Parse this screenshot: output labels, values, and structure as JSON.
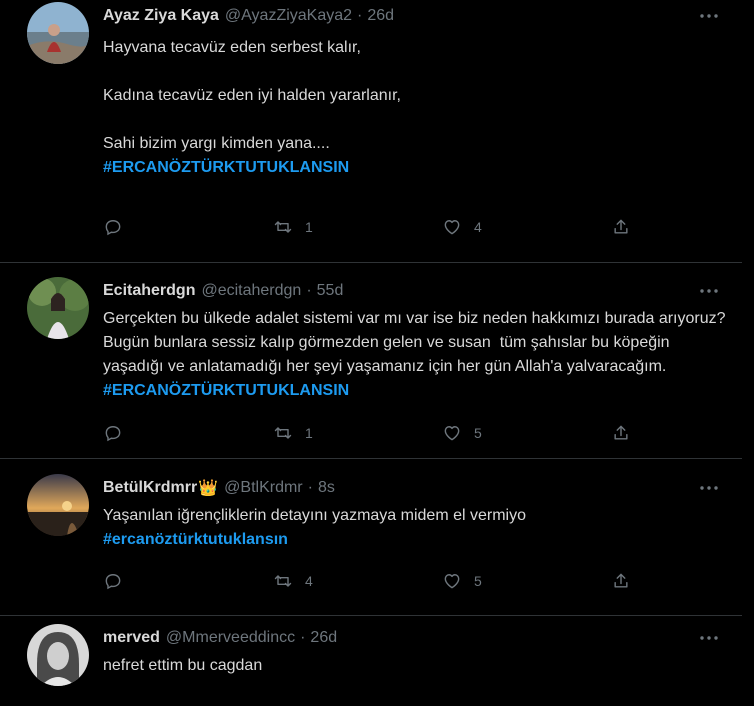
{
  "tweets": [
    {
      "name": "Ayaz Ziya Kaya",
      "handle": "@AyazZiyaKaya2",
      "separator": "·",
      "time": "26d",
      "text": "Hayvana tecavüz eden serbest kalır,\n\nKadına tecavüz eden iyi halden yararlanır,\n\nSahi bizim yargı kimden yana....\n",
      "hashtag": "#ERCANÖZTÜRKTUTUKLANSIN",
      "replies": "",
      "retweets": "1",
      "likes": "4"
    },
    {
      "name": "Ecitaherdgn",
      "handle": "@ecitaherdgn",
      "separator": "·",
      "time": "55d",
      "text": "Gerçekten bu ülkede adalet sistemi var mı var ise biz neden hakkımızı burada arıyoruz? Bugün bunlara sessiz kalıp görmezden gelen ve susan  tüm şahıslar bu köpeğin yaşadığı ve anlatamadığı her şeyi yaşamanız için her gün Allah'a yalvaracağım. ",
      "hashtag": "#ERCANÖZTÜRKTUTUKLANSIN",
      "replies": "",
      "retweets": "1",
      "likes": "5"
    },
    {
      "name": "BetülKrdmrr",
      "name_emoji": "👑",
      "handle": "@BtlKrdmr",
      "separator": "·",
      "time": "8s",
      "text": "Yaşanılan iğrençliklerin detayını yazmaya midem el vermiyo\n",
      "hashtag": "#ercanöztürktutuklansın",
      "replies": "",
      "retweets": "4",
      "likes": "5"
    },
    {
      "name": "merved",
      "handle": "@Mmerveeddincc",
      "separator": "·",
      "time": "26d",
      "text": "nefret ettim bu cagdan",
      "hashtag": "",
      "replies": "",
      "retweets": "",
      "likes": ""
    }
  ],
  "colors": {
    "background": "#000000",
    "text": "#d9d9d9",
    "secondary": "#6e767d",
    "hashtag": "#1d9bf0",
    "divider": "#2f3336"
  },
  "icons": [
    "more-icon",
    "reply-icon",
    "retweet-icon",
    "like-icon",
    "share-icon",
    "crown-emoji"
  ]
}
